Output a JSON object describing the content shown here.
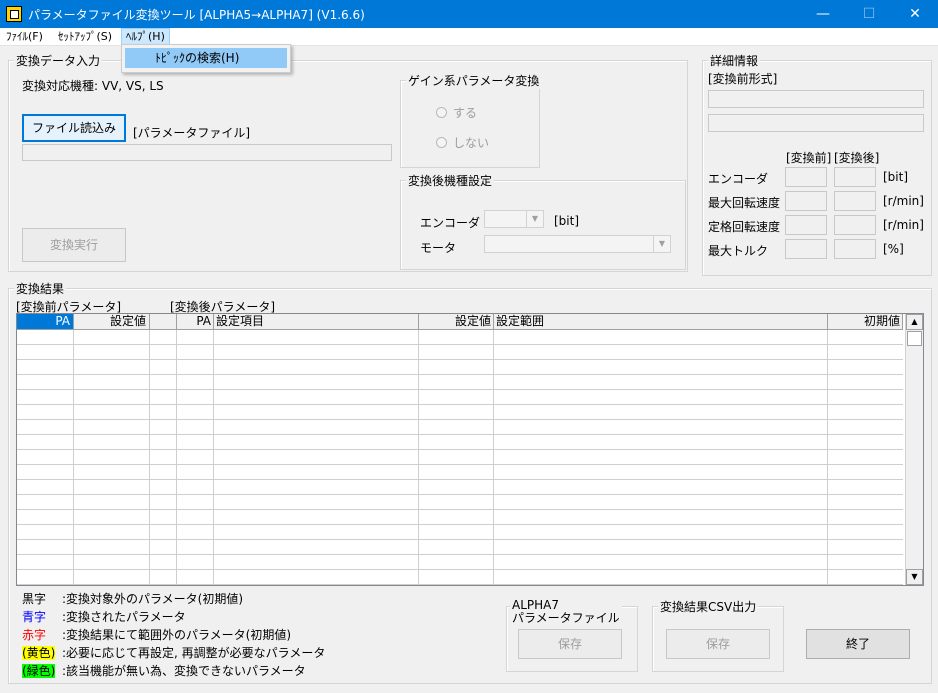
{
  "window": {
    "title": "パラメータファイル変換ツール [ALPHA5→ALPHA7] (V1.6.6)",
    "minimize_glyph": "—",
    "maximize_glyph": "☐",
    "close_glyph": "✕"
  },
  "menubar": {
    "file": "ﾌｧｲﾙ(F)",
    "setup": "ｾｯﾄｱｯﾌﾟ(S)",
    "help": "ﾍﾙﾌﾟ(H)"
  },
  "help_menu": {
    "items": [
      "ﾄﾋﾟｯｸの検索(H)"
    ]
  },
  "input_group": {
    "title": "変換データ入力",
    "supported_models": "変換対応機種: VV, VS, LS",
    "load_button": "ファイル読込み",
    "param_file_label": "[パラメータファイル]",
    "file_path_value": "",
    "execute_button": "変換実行"
  },
  "gain_group": {
    "title": "ゲイン系パラメータ変換",
    "option_yes": "する",
    "option_no": "しない"
  },
  "target_model_group": {
    "title": "変換後機種設定",
    "encoder_label": "エンコーダ",
    "encoder_unit": "[bit]",
    "motor_label": "モータ",
    "encoder_value": "",
    "motor_value": ""
  },
  "details_group": {
    "title": "詳細情報",
    "source_format_label": "[変換前形式]",
    "before_header": "[変換前]",
    "after_header": "[変換後]",
    "rows": [
      {
        "label": "エンコーダ",
        "unit": "[bit]"
      },
      {
        "label": "最大回転速度",
        "unit": "[r/min]"
      },
      {
        "label": "定格回転速度",
        "unit": "[r/min]"
      },
      {
        "label": "最大トルク",
        "unit": "[%]"
      }
    ]
  },
  "results_group": {
    "title": "変換結果",
    "before_params_label": "[変換前パラメータ]",
    "after_params_label": "[変換後パラメータ]",
    "columns": [
      "PA",
      "設定値",
      "",
      "PA",
      "設定項目",
      "設定値",
      "設定範囲",
      "初期値"
    ]
  },
  "color_legend": [
    {
      "key": "黒字",
      "desc": ":変換対象外のパラメータ(初期値)",
      "color": "#000000",
      "bg": ""
    },
    {
      "key": "青字",
      "desc": ":変換されたパラメータ",
      "color": "#0000ff",
      "bg": ""
    },
    {
      "key": "赤字",
      "desc": ":変換結果にて範囲外のパラメータ(初期値)",
      "color": "#ff0000",
      "bg": ""
    },
    {
      "key": "(黄色)",
      "desc": ":必要に応じて再設定, 再調整が必要なパラメータ",
      "color": "#000000",
      "bg": "#ffff00"
    },
    {
      "key": "(緑色)",
      "desc": ":該当機能が無い為、変換できないパラメータ",
      "color": "#000000",
      "bg": "#00ff00"
    }
  ],
  "alpha7_group": {
    "title_line1": "ALPHA7",
    "title_line2": "パラメータファイル",
    "save_button": "保存"
  },
  "csv_group": {
    "title": "変換結果CSV出力",
    "save_button": "保存"
  },
  "exit_button": "終了",
  "colors": {
    "titlebar": "#0078d7",
    "selection": "#0078d7",
    "menu_highlight": "#91c9f7"
  }
}
